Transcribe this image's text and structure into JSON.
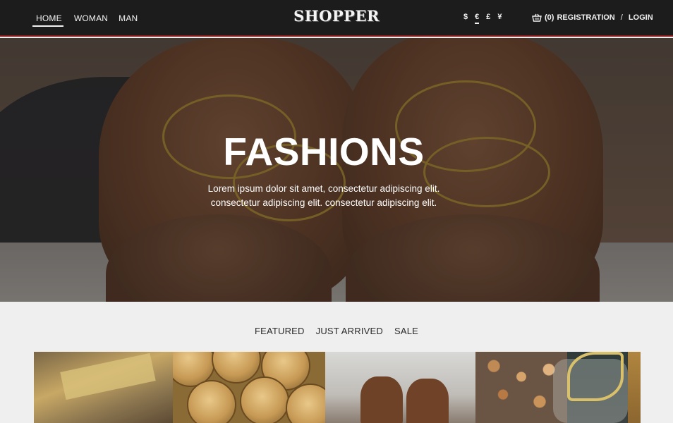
{
  "header": {
    "nav": [
      {
        "label": "HOME",
        "active": true
      },
      {
        "label": "WOMAN",
        "active": false
      },
      {
        "label": "MAN",
        "active": false
      }
    ],
    "logo": "SHOPPER",
    "currencies": [
      {
        "symbol": "$",
        "selected": false
      },
      {
        "symbol": "€",
        "selected": true
      },
      {
        "symbol": "£",
        "selected": false
      },
      {
        "symbol": "¥",
        "selected": false
      }
    ],
    "cart_icon": "basket-icon",
    "cart_count": "(0)",
    "registration_label": "REGISTRATION",
    "separator": "/",
    "login_label": "LOGIN",
    "accent_color": "#8b1a1a"
  },
  "hero": {
    "title": "FASHIONS",
    "text": "Lorem ipsum dolor sit amet, consectetur adipiscing elit. consectetur adipiscing elit. consectetur adipiscing elit."
  },
  "tabs": [
    "FEATURED",
    "JUST ARRIVED",
    "SALE"
  ]
}
